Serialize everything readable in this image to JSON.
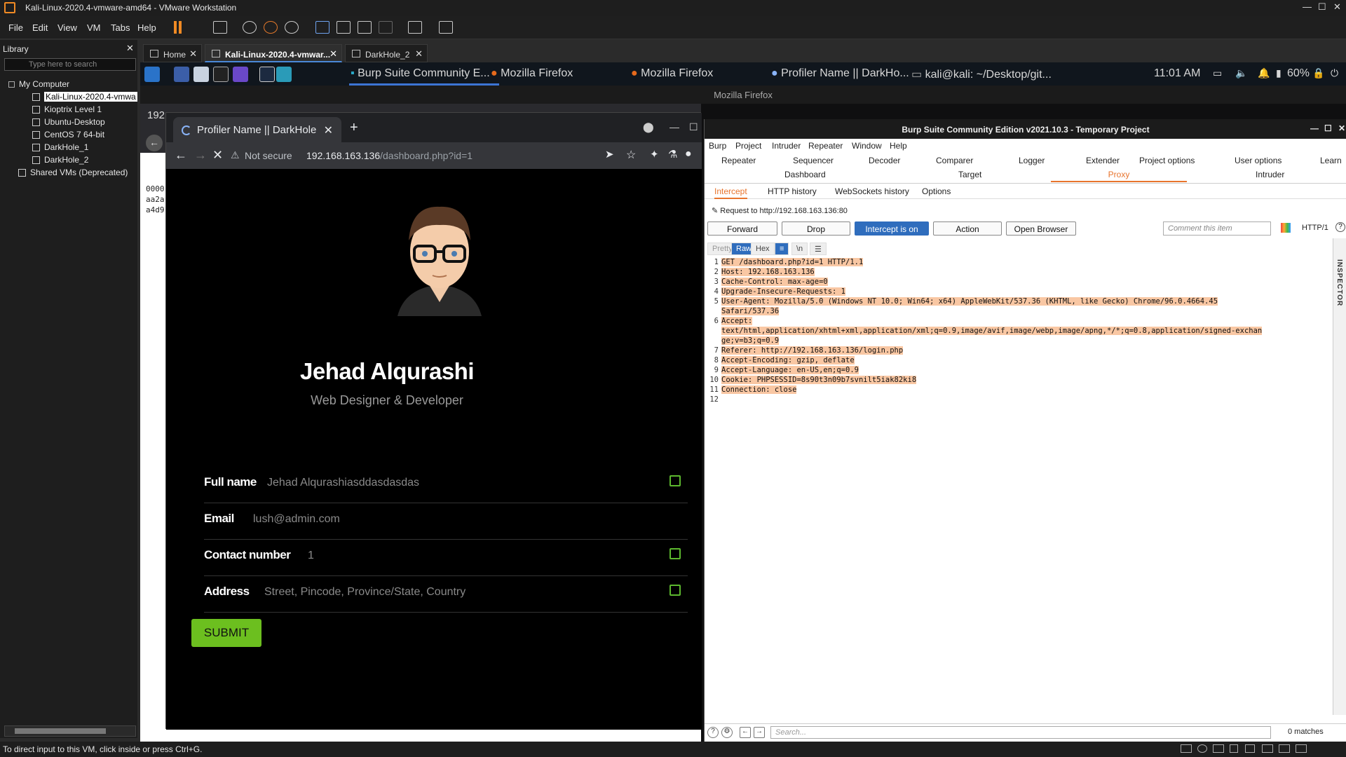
{
  "vmware": {
    "title": "Kali-Linux-2020.4-vmware-amd64 - VMware Workstation",
    "menu": [
      "File",
      "Edit",
      "View",
      "VM",
      "Tabs",
      "Help"
    ],
    "status": "To direct input to this VM, click inside or press Ctrl+G."
  },
  "library": {
    "title": "Library",
    "search_placeholder": "Type here to search",
    "root": "My Computer",
    "vms": [
      "Kali-Linux-2020.4-vmwa",
      "Kioptrix Level 1",
      "Ubuntu-Desktop",
      "CentOS 7 64-bit",
      "DarkHole_1",
      "DarkHole_2"
    ],
    "shared": "Shared VMs (Deprecated)"
  },
  "vm_tabs": [
    "Home",
    "Kali-Linux-2020.4-vmwar...",
    "DarkHole_2"
  ],
  "kali_panel": {
    "tasks": [
      "Burp Suite Community E...",
      "Mozilla Firefox",
      "Mozilla Firefox",
      "Profiler Name || DarkHo...",
      "kali@kali: ~/Desktop/git..."
    ],
    "time": "11:01 AM",
    "battery": "60%"
  },
  "firefox_behind": {
    "title": "Mozilla Firefox",
    "addr": "192.",
    "mono": [
      "0000",
      "aa2a",
      "a4d9"
    ]
  },
  "chrome": {
    "tab_title": "Profiler Name || DarkHole",
    "not_secure": "Not secure",
    "url_host": "192.168.163.136",
    "url_path": "/dashboard.php?id=1"
  },
  "profile": {
    "name": "Jehad Alqurashi",
    "role": "Web Designer & Developer",
    "fields": [
      {
        "label": "Full name",
        "value": "Jehad Alqurashiasddasdasdas"
      },
      {
        "label": "Email",
        "value": "lush@admin.com"
      },
      {
        "label": "Contact number",
        "value": "1"
      },
      {
        "label": "Address",
        "value": "Street, Pincode, Province/State, Country"
      }
    ],
    "submit": "SUBMIT"
  },
  "burp": {
    "title": "Burp Suite Community Edition v2021.10.3 - Temporary Project",
    "menu": [
      "Burp",
      "Project",
      "Intruder",
      "Repeater",
      "Window",
      "Help"
    ],
    "tabs_row1": [
      "Repeater",
      "Sequencer",
      "Decoder",
      "Comparer",
      "Logger",
      "Extender",
      "Project options",
      "User options",
      "Learn"
    ],
    "tabs_row2": [
      "Dashboard",
      "Target",
      "Proxy",
      "Intruder"
    ],
    "proxy_tabs": [
      "Intercept",
      "HTTP history",
      "WebSockets history",
      "Options"
    ],
    "request_to": "Request to http://192.168.163.136:80",
    "buttons": [
      "Forward",
      "Drop",
      "Intercept is on",
      "Action",
      "Open Browser"
    ],
    "comment_placeholder": "Comment this item",
    "http_version": "HTTP/1",
    "view_tabs": [
      "Pretty",
      "Raw",
      "Hex"
    ],
    "view_newline": "\\n",
    "inspector": "INSPECTOR",
    "lines": [
      {
        "n": "1",
        "text": "GET /dashboard.php?id=1 HTTP/1.1"
      },
      {
        "n": "2",
        "text": "Host: 192.168.163.136"
      },
      {
        "n": "3",
        "text": "Cache-Control: max-age=0"
      },
      {
        "n": "4",
        "text": "Upgrade-Insecure-Requests: 1"
      },
      {
        "n": "5",
        "text": "User-Agent: Mozilla/5.0 (Windows NT 10.0; Win64; x64) AppleWebKit/537.36 (KHTML, like Gecko) Chrome/96.0.4664.45"
      },
      {
        "n": "",
        "text": "Safari/537.36"
      },
      {
        "n": "6",
        "text": "Accept:"
      },
      {
        "n": "",
        "text": "text/html,application/xhtml+xml,application/xml;q=0.9,image/avif,image/webp,image/apng,*/*;q=0.8,application/signed-exchan"
      },
      {
        "n": "",
        "text": "ge;v=b3;q=0.9"
      },
      {
        "n": "7",
        "text": "Referer: http://192.168.163.136/login.php"
      },
      {
        "n": "8",
        "text": "Accept-Encoding: gzip, deflate"
      },
      {
        "n": "9",
        "text": "Accept-Language: en-US,en;q=0.9"
      },
      {
        "n": "10",
        "text": "Cookie: PHPSESSID=8s90t3n09b7svnilt5iak82ki8"
      },
      {
        "n": "11",
        "text": "Connection: close"
      },
      {
        "n": "12",
        "text": ""
      }
    ],
    "search_placeholder": "Search...",
    "matches": "0 matches"
  }
}
